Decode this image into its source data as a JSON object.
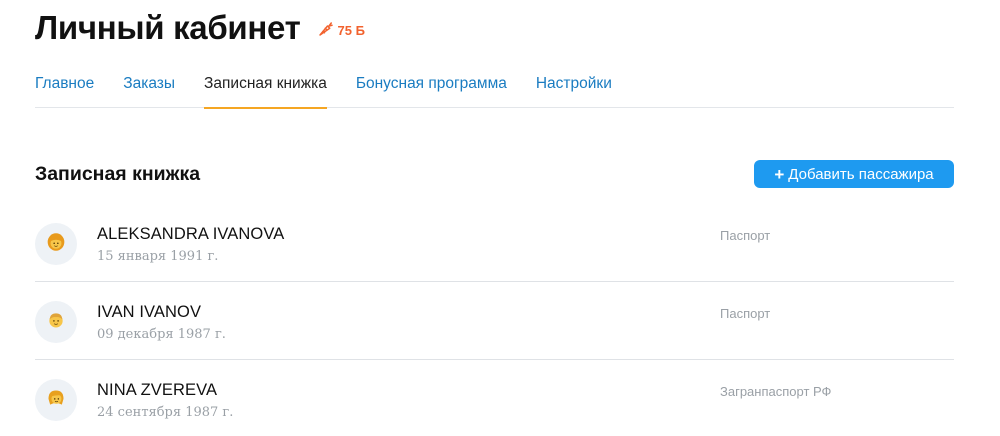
{
  "header": {
    "title": "Личный кабинет",
    "bonus": "75 Б",
    "bonus_icon": "carrot-icon",
    "bonus_color": "#f2622e"
  },
  "tabs": [
    {
      "label": "Главное",
      "active": false
    },
    {
      "label": "Заказы",
      "active": false
    },
    {
      "label": "Записная книжка",
      "active": true
    },
    {
      "label": "Бонусная программа",
      "active": false
    },
    {
      "label": "Настройки",
      "active": false
    }
  ],
  "section": {
    "title": "Записная книжка",
    "add_button": "Добавить пассажира",
    "add_icon": "plus-icon"
  },
  "passengers": [
    {
      "name": "ALEKSANDRA IVANOVA",
      "birth_date": "15 января 1991 г.",
      "document": "Паспорт",
      "avatar_icon": "woman-avatar-icon"
    },
    {
      "name": "IVAN IVANOV",
      "birth_date": "09 декабря 1987 г.",
      "document": "Паспорт",
      "avatar_icon": "man-avatar-icon"
    },
    {
      "name": "NINA ZVEREVA",
      "birth_date": "24 сентября 1987 г.",
      "document": "Загранпаспорт РФ",
      "avatar_icon": "woman-avatar-icon"
    }
  ],
  "colors": {
    "link": "#1a7cc1",
    "accent_underline": "#f5a623",
    "primary_button": "#1e9af0"
  }
}
